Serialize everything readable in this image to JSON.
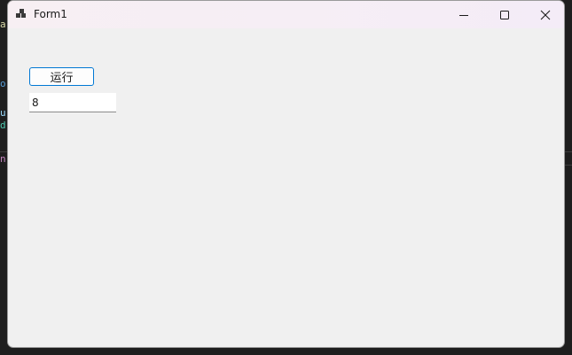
{
  "window": {
    "title": "Form1",
    "controls": {
      "minimize": "minimize",
      "maximize": "maximize",
      "close": "close"
    }
  },
  "form": {
    "run_button_label": "运行",
    "input_value": "8"
  },
  "background_code": {
    "lines": [
      "a",
      "o",
      "u",
      "d",
      "n"
    ]
  },
  "colors": {
    "accent": "#0078d4",
    "window_bg": "#f0f0f0",
    "titlebar_bg": "#f6eef5",
    "backdrop": "#1e1e1e"
  }
}
